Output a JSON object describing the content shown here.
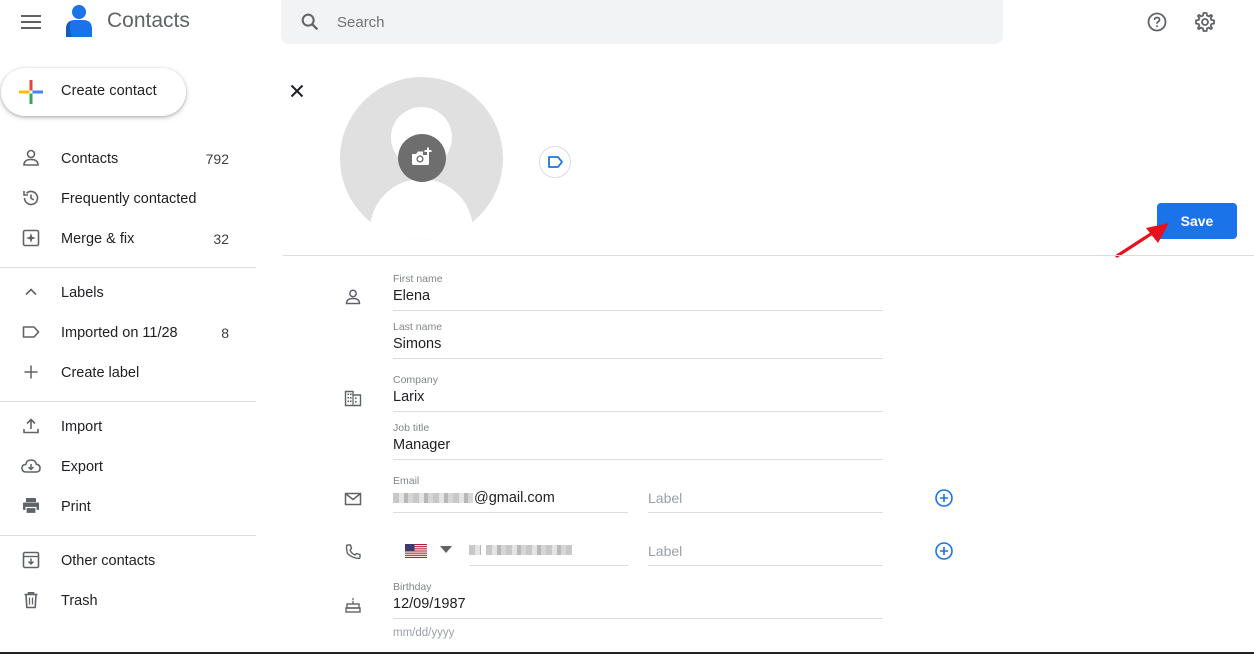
{
  "app": {
    "title": "Contacts"
  },
  "search": {
    "placeholder": "Search"
  },
  "sidebar": {
    "create_label": "Create contact",
    "items": [
      {
        "label": "Contacts",
        "count": "792",
        "icon": "person-icon"
      },
      {
        "label": "Frequently contacted",
        "count": "",
        "icon": "history-icon"
      },
      {
        "label": "Merge & fix",
        "count": "32",
        "icon": "merge-fix-icon"
      },
      {
        "label": "Labels",
        "count": "",
        "icon": "chevron-up-icon"
      },
      {
        "label": "Imported on 11/28",
        "count": "8",
        "icon": "label-icon"
      },
      {
        "label": "Create label",
        "count": "",
        "icon": "plus-icon"
      },
      {
        "label": "Import",
        "count": "",
        "icon": "upload-icon"
      },
      {
        "label": "Export",
        "count": "",
        "icon": "cloud-download-icon"
      },
      {
        "label": "Print",
        "count": "",
        "icon": "printer-icon"
      },
      {
        "label": "Other contacts",
        "count": "",
        "icon": "archive-icon"
      },
      {
        "label": "Trash",
        "count": "",
        "icon": "trash-icon"
      }
    ]
  },
  "editor": {
    "save_label": "Save",
    "first_name": {
      "label": "First name",
      "value": "Elena"
    },
    "last_name": {
      "label": "Last name",
      "value": "Simons"
    },
    "company": {
      "label": "Company",
      "value": "Larix"
    },
    "job_title": {
      "label": "Job title",
      "value": "Manager"
    },
    "email": {
      "label": "Email",
      "value_suffix": "@gmail.com",
      "label_placeholder": "Label"
    },
    "phone": {
      "label_placeholder": "Label",
      "country": "US"
    },
    "birthday": {
      "label": "Birthday",
      "value": "12/09/1987",
      "placeholder": "mm/dd/yyyy"
    }
  },
  "colors": {
    "accent": "#1a73e8",
    "annotation_arrow": "#e8101a",
    "icon_gray": "#5f6368"
  }
}
